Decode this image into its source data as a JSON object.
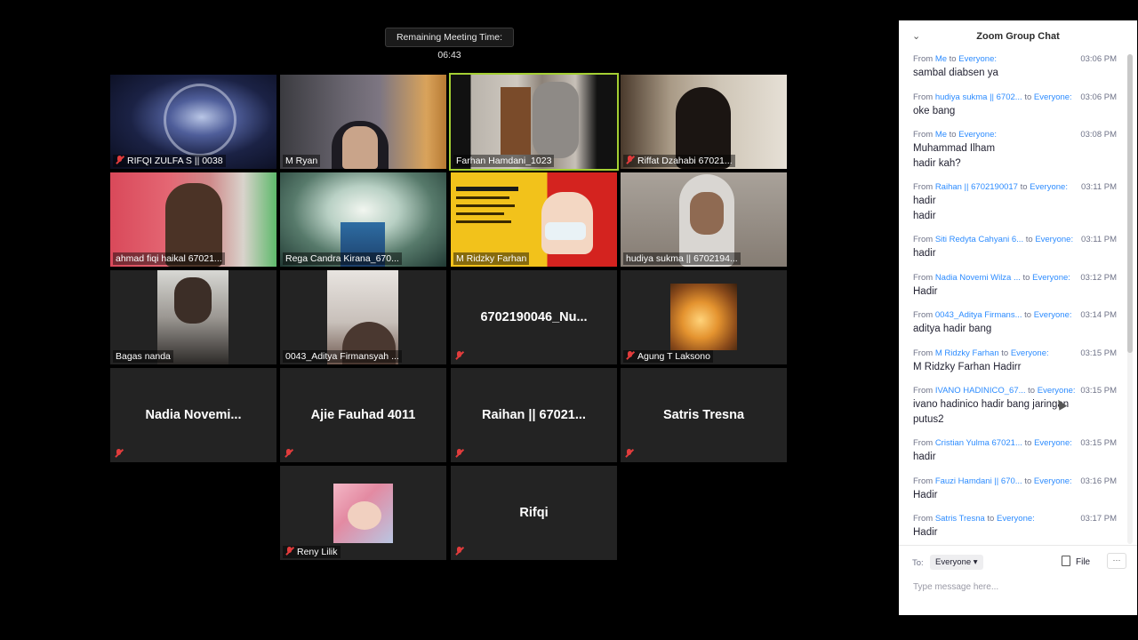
{
  "meeting": {
    "remaining_time": "Remaining Meeting Time: 06:43"
  },
  "participants": [
    {
      "name": "RIFQI ZULFA S || 0038",
      "muted": true,
      "video": true
    },
    {
      "name": "M Ryan",
      "muted": false,
      "video": true
    },
    {
      "name": "Farhan Hamdani_1023",
      "muted": false,
      "video": true,
      "active_speaker": true
    },
    {
      "name": "Riffat Dzahabi 67021...",
      "muted": true,
      "video": true
    },
    {
      "name": "ahmad fiqi haikal 67021...",
      "muted": false,
      "video": true
    },
    {
      "name": "Rega Candra Kirana_670...",
      "muted": false,
      "video": true
    },
    {
      "name": "M Ridzky Farhan",
      "muted": false,
      "video": true
    },
    {
      "name": "hudiya sukma || 6702194...",
      "muted": false,
      "video": true
    },
    {
      "name": "Bagas nanda",
      "muted": false,
      "video": true
    },
    {
      "name": "0043_Aditya Firmansyah ...",
      "muted": false,
      "video": true
    },
    {
      "name": "6702190046_Nu...",
      "muted": true,
      "video": false
    },
    {
      "name": "Agung T Laksono",
      "muted": true,
      "video": true
    },
    {
      "name": "Nadia  Novemi...",
      "muted": true,
      "video": false
    },
    {
      "name": "Ajie Fauhad 4011",
      "muted": true,
      "video": false
    },
    {
      "name": "Raihan || 67021...",
      "muted": true,
      "video": false
    },
    {
      "name": "Satris Tresna",
      "muted": true,
      "video": false
    },
    {
      "name": "Reny Lilik",
      "muted": true,
      "video": true
    },
    {
      "name": "Rifqi",
      "muted": true,
      "video": false
    }
  ],
  "chat": {
    "title": "Zoom Group Chat",
    "messages": [
      {
        "from": "From",
        "sender": "Me",
        "to": "to",
        "recipient": "Everyone:",
        "time": "03:06 PM",
        "lines": [
          "sambal diabsen ya"
        ]
      },
      {
        "from": "From",
        "sender": "hudiya sukma || 6702...",
        "to": "to",
        "recipient": "Everyone:",
        "time": "03:06 PM",
        "lines": [
          "oke bang"
        ]
      },
      {
        "from": "From",
        "sender": "Me",
        "to": "to",
        "recipient": "Everyone:",
        "time": "03:08 PM",
        "lines": [
          "Muhammad Ilham",
          "hadir kah?"
        ]
      },
      {
        "from": "From",
        "sender": "Raihan || 6702190017",
        "to": "to",
        "recipient": "Everyone:",
        "time": "03:11 PM",
        "lines": [
          "hadir",
          "hadir"
        ]
      },
      {
        "from": "From",
        "sender": "Siti Redyta Cahyani 6...",
        "to": "to",
        "recipient": "Everyone:",
        "time": "03:11 PM",
        "lines": [
          "hadir"
        ]
      },
      {
        "from": "From",
        "sender": "Nadia Novemi Wilza ...",
        "to": "to",
        "recipient": "Everyone:",
        "time": "03:12 PM",
        "lines": [
          "Hadir"
        ]
      },
      {
        "from": "From",
        "sender": "0043_Aditya Firmans...",
        "to": "to",
        "recipient": "Everyone:",
        "time": "03:14 PM",
        "lines": [
          "aditya hadir bang"
        ]
      },
      {
        "from": "From",
        "sender": "M Ridzky Farhan",
        "to": "to",
        "recipient": "Everyone:",
        "time": "03:15 PM",
        "lines": [
          "M Ridzky Farhan Hadirr"
        ]
      },
      {
        "from": "From",
        "sender": "IVANO HADINICO_67...",
        "to": "to",
        "recipient": "Everyone:",
        "time": "03:15 PM",
        "lines": [
          "ivano hadinico hadir bang jaringan",
          "putus2"
        ]
      },
      {
        "from": "From",
        "sender": "Cristian Yulma 67021...",
        "to": "to",
        "recipient": "Everyone:",
        "time": "03:15 PM",
        "lines": [
          "hadir"
        ]
      },
      {
        "from": "From",
        "sender": "Fauzi Hamdani || 670...",
        "to": "to",
        "recipient": "Everyone:",
        "time": "03:16 PM",
        "lines": [
          "Hadir"
        ]
      },
      {
        "from": "From",
        "sender": "Satris Tresna",
        "to": "to",
        "recipient": "Everyone:",
        "time": "03:17 PM",
        "lines": [
          "Hadir"
        ]
      }
    ],
    "to_label": "To:",
    "recipient_select": "Everyone",
    "file_label": "File",
    "more_label": "···",
    "input_placeholder": "Type message here...",
    "icons": {
      "collapse": "chevron-down-icon",
      "file": "file-icon",
      "more": "more-icon",
      "muted": "muted-mic-icon"
    }
  },
  "colors": {
    "accent": "#2d8cff",
    "active_speaker": "#a4cf33",
    "muted": "#e23c3c",
    "tile_bg": "#232323"
  }
}
